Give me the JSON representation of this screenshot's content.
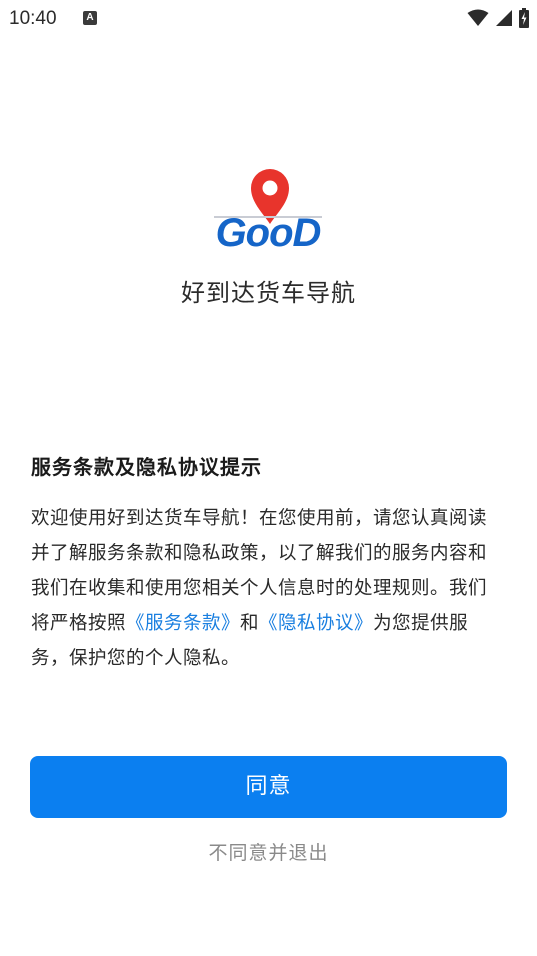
{
  "status_bar": {
    "time": "10:40",
    "notification_badge": "A",
    "icons": [
      "wifi-icon",
      "signal-icon",
      "battery-charging-icon"
    ]
  },
  "app": {
    "logo_text": "GooD",
    "logo_icon": "map-pin-icon",
    "name": "好到达货车导航"
  },
  "dialog": {
    "title": "服务条款及隐私协议提示",
    "text_before": "欢迎使用好到达货车导航！在您使用前，请您认真阅读并了解服务条款和隐私政策，以了解我们的服务内容和我们在收集和使用您相关个人信息时的处理规则。我们将严格按照",
    "link_terms": "《服务条款》",
    "text_and": "和",
    "link_privacy": "《隐私协议》",
    "text_after": "为您提供服务，保护您的个人隐私。"
  },
  "buttons": {
    "agree": "同意",
    "disagree": "不同意并退出"
  },
  "colors": {
    "primary": "#0b7ff0",
    "link": "#1a7fe0",
    "logo_red": "#e8342c",
    "logo_blue": "#1565c8"
  }
}
